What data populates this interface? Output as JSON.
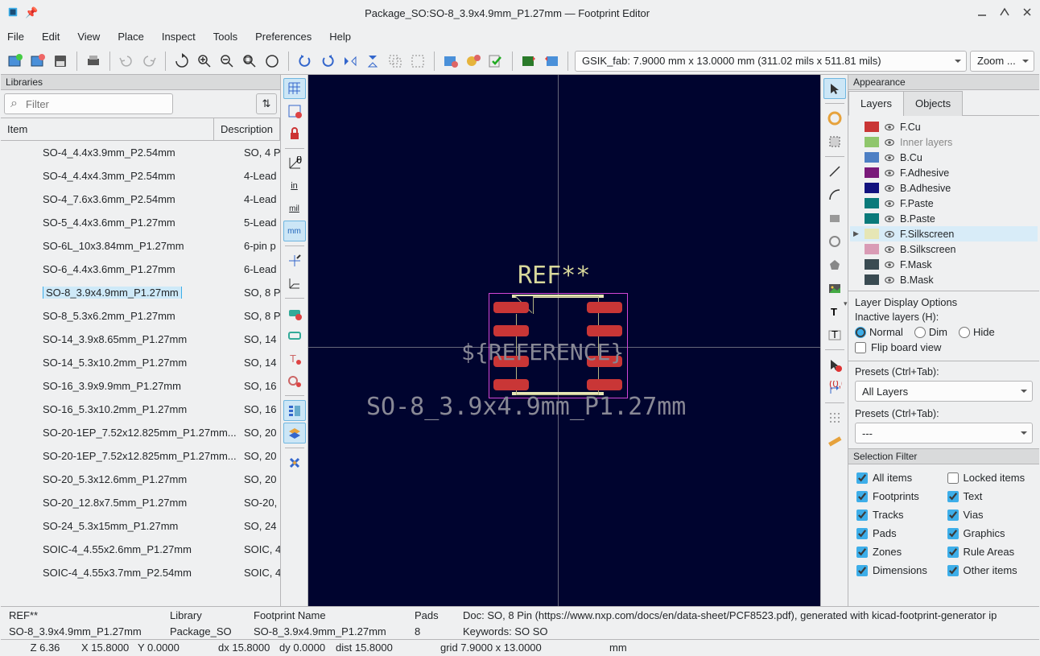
{
  "title": "Package_SO:SO-8_3.9x4.9mm_P1.27mm — Footprint Editor",
  "menu": [
    "File",
    "Edit",
    "View",
    "Place",
    "Inspect",
    "Tools",
    "Preferences",
    "Help"
  ],
  "grid_combo": "GSIK_fab: 7.9000 mm x 13.0000 mm (311.02 mils x 511.81 mils)",
  "zoom_combo": "Zoom ...",
  "libraries_title": "Libraries",
  "filter_placeholder": "Filter",
  "col_item": "Item",
  "col_desc": "Description",
  "rows": [
    {
      "n": "SO-4_4.4x3.9mm_P2.54mm",
      "d": "SO, 4 P"
    },
    {
      "n": "SO-4_4.4x4.3mm_P2.54mm",
      "d": "4-Lead"
    },
    {
      "n": "SO-4_7.6x3.6mm_P2.54mm",
      "d": "4-Lead"
    },
    {
      "n": "SO-5_4.4x3.6mm_P1.27mm",
      "d": "5-Lead"
    },
    {
      "n": "SO-6L_10x3.84mm_P1.27mm",
      "d": "6-pin p"
    },
    {
      "n": "SO-6_4.4x3.6mm_P1.27mm",
      "d": "6-Lead"
    },
    {
      "n": "SO-8_3.9x4.9mm_P1.27mm",
      "d": "SO, 8 P",
      "sel": true
    },
    {
      "n": "SO-8_5.3x6.2mm_P1.27mm",
      "d": "SO, 8 P"
    },
    {
      "n": "SO-14_3.9x8.65mm_P1.27mm",
      "d": "SO, 14"
    },
    {
      "n": "SO-14_5.3x10.2mm_P1.27mm",
      "d": "SO, 14"
    },
    {
      "n": "SO-16_3.9x9.9mm_P1.27mm",
      "d": "SO, 16"
    },
    {
      "n": "SO-16_5.3x10.2mm_P1.27mm",
      "d": "SO, 16"
    },
    {
      "n": "SO-20-1EP_7.52x12.825mm_P1.27mm...",
      "d": "SO, 20"
    },
    {
      "n": "SO-20-1EP_7.52x12.825mm_P1.27mm...",
      "d": "SO, 20"
    },
    {
      "n": "SO-20_5.3x12.6mm_P1.27mm",
      "d": "SO, 20"
    },
    {
      "n": "SO-20_12.8x7.5mm_P1.27mm",
      "d": "SO-20,"
    },
    {
      "n": "SO-24_5.3x15mm_P1.27mm",
      "d": "SO, 24"
    },
    {
      "n": "SOIC-4_4.55x2.6mm_P1.27mm",
      "d": "SOIC, 4"
    },
    {
      "n": "SOIC-4_4.55x3.7mm_P2.54mm",
      "d": "SOIC, 4"
    }
  ],
  "canvas": {
    "ref": "REF**",
    "overlay": "${REFERENCE}",
    "fpname": "SO-8_3.9x4.9mm_P1.27mm"
  },
  "appearance_title": "Appearance",
  "tabs": {
    "layers": "Layers",
    "objects": "Objects"
  },
  "layers": [
    {
      "c": "#c93636",
      "n": "F.Cu"
    },
    {
      "c": "#8fc66c",
      "n": "Inner layers",
      "dim": true
    },
    {
      "c": "#4d7fc4",
      "n": "B.Cu"
    },
    {
      "c": "#7a1a7a",
      "n": "F.Adhesive"
    },
    {
      "c": "#12127e",
      "n": "B.Adhesive"
    },
    {
      "c": "#0a7a7a",
      "n": "F.Paste"
    },
    {
      "c": "#0a7a7a",
      "n": "B.Paste"
    },
    {
      "c": "#e6e6b5",
      "n": "F.Silkscreen",
      "sel": true
    },
    {
      "c": "#d99bb5",
      "n": "B.Silkscreen"
    },
    {
      "c": "#3a4b52",
      "n": "F.Mask"
    },
    {
      "c": "#3a4b52",
      "n": "B.Mask"
    }
  ],
  "layer_display": "Layer Display Options",
  "inactive": "Inactive layers (H):",
  "rad": {
    "normal": "Normal",
    "dim": "Dim",
    "hide": "Hide"
  },
  "flip": "Flip board view",
  "presets": "Presets (Ctrl+Tab):",
  "all_layers": "All Layers",
  "dashes": "---",
  "selfilter": "Selection Filter",
  "filters": {
    "all": "All items",
    "locked": "Locked items",
    "fp": "Footprints",
    "text": "Text",
    "tracks": "Tracks",
    "vias": "Vias",
    "pads": "Pads",
    "gfx": "Graphics",
    "zones": "Zones",
    "rule": "Rule Areas",
    "dim": "Dimensions",
    "other": "Other items"
  },
  "sb1": {
    "ref": "REF**",
    "lib_h": "Library",
    "fpn_h": "Footprint Name",
    "pads_h": "Pads",
    "doc": "Doc: SO, 8 Pin (https://www.nxp.com/docs/en/data-sheet/PCF8523.pdf), generated with kicad-footprint-generator ip"
  },
  "sb2": {
    "fp": "SO-8_3.9x4.9mm_P1.27mm",
    "lib": "Package_SO",
    "fpn": "SO-8_3.9x4.9mm_P1.27mm",
    "pads": "8",
    "kw": "Keywords: SO SO"
  },
  "sb3": {
    "z": "Z 6.36",
    "x": "X 15.8000",
    "y": "Y 0.0000",
    "dx": "dx 15.8000",
    "dy": "dy 0.0000",
    "dist": "dist 15.8000",
    "grid": "grid 7.9000 x 13.0000",
    "unit": "mm"
  }
}
